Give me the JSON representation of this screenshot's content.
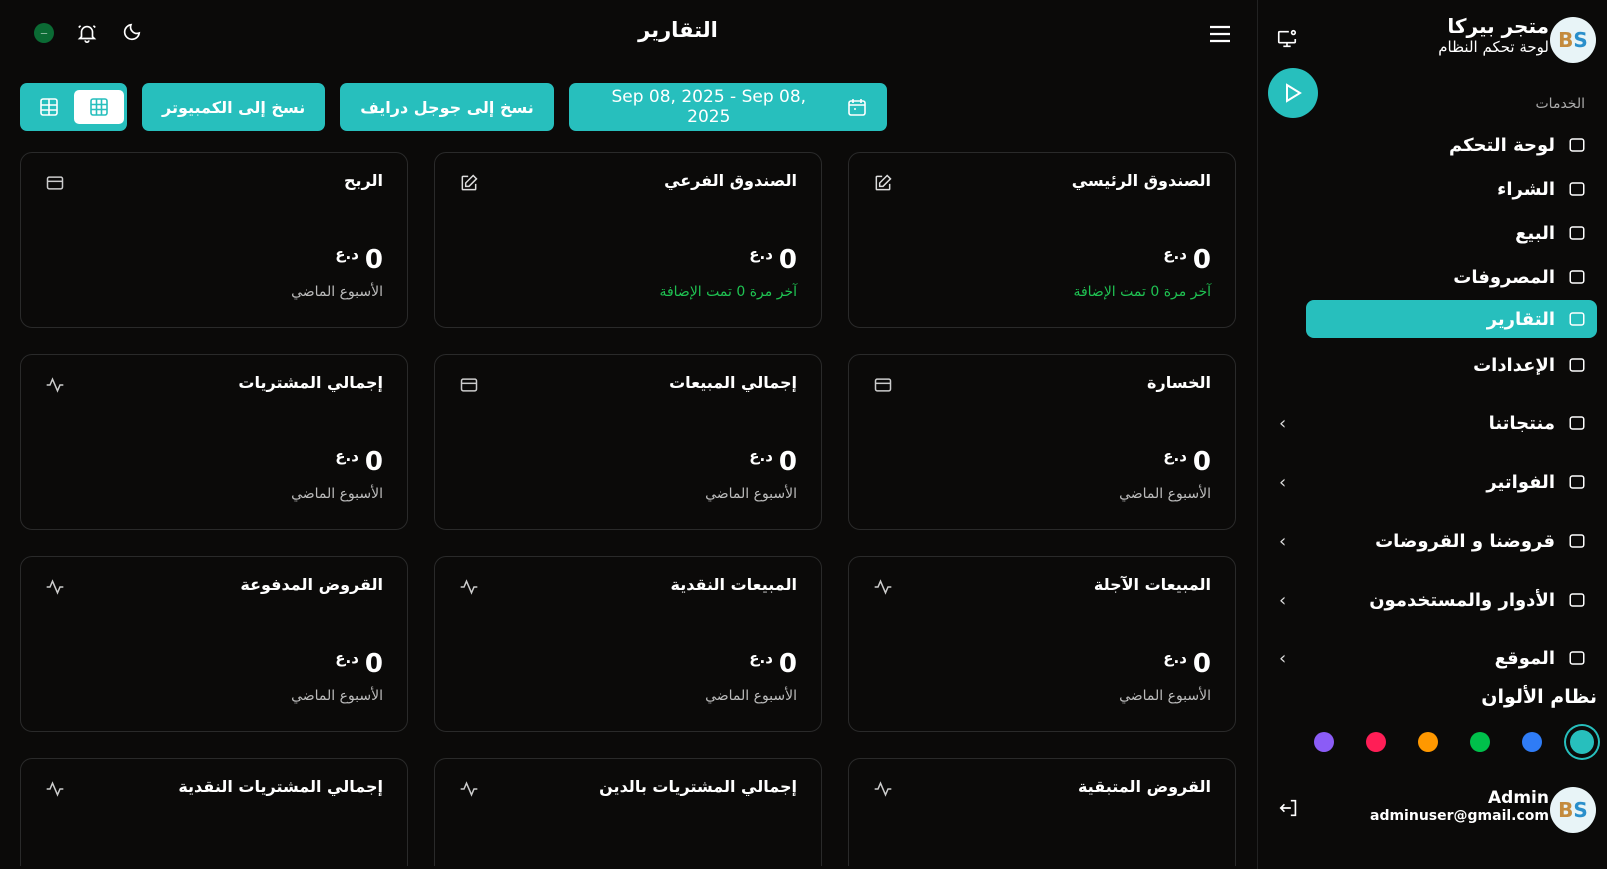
{
  "sidebar": {
    "brand_name": "متجر بيركا",
    "brand_sub": "لوحة تحكم النظام",
    "logo_text": "BS",
    "section_label": "الخدمات",
    "items": [
      {
        "label": "لوحة التحكم",
        "icon": "grid-icon"
      },
      {
        "label": "الشراء",
        "icon": "shopping-bag-icon"
      },
      {
        "label": "البيع",
        "icon": "pie-chart-icon"
      },
      {
        "label": "المصروفات",
        "icon": "credit-card-icon"
      },
      {
        "label": "التقارير",
        "icon": "report-icon",
        "active": true
      },
      {
        "label": "الإعدادات",
        "icon": "gear-icon"
      },
      {
        "label": "منتجاتنا",
        "icon": "basket-icon"
      },
      {
        "label": "الفواتير",
        "icon": "terminal-icon"
      },
      {
        "label": "قروضنا و القروضات",
        "icon": "money-icon"
      },
      {
        "label": "الأدوار والمستخدمون",
        "icon": "robot-icon"
      },
      {
        "label": "الموقع",
        "icon": "router-icon"
      }
    ],
    "color_scheme_title": "نظام الألوان",
    "colors": [
      "#27bfbd",
      "#2f7cf6",
      "#00c04b",
      "#ff9800",
      "#ff1e56",
      "#8b5cf6"
    ],
    "user": {
      "name": "Admin",
      "email": "adminuser@gmail.com"
    }
  },
  "header": {
    "title": "التقارير"
  },
  "toolbar": {
    "date_range": "Sep 08, 2025 - Sep 08, 2025",
    "copy_drive": "نسخ إلى جوجل درايف",
    "copy_computer": "نسخ إلى الكمبيوتر"
  },
  "cards": [
    {
      "title": "الصندوق الرئيسي",
      "value": "0",
      "currency": "د.ع",
      "sub": "آخر مرة 0 تمت الإضافة",
      "green": true,
      "icon": "edit"
    },
    {
      "title": "الصندوق الفرعي",
      "value": "0",
      "currency": "د.ع",
      "sub": "آخر مرة 0 تمت الإضافة",
      "green": true,
      "icon": "edit"
    },
    {
      "title": "الربح",
      "value": "0",
      "currency": "د.ع",
      "sub": "الأسبوع الماضي",
      "icon": "card"
    },
    {
      "title": "الخسارة",
      "value": "0",
      "currency": "د.ع",
      "sub": "الأسبوع الماضي",
      "icon": "card"
    },
    {
      "title": "إجمالي المبيعات",
      "value": "0",
      "currency": "د.ع",
      "sub": "الأسبوع الماضي",
      "icon": "card"
    },
    {
      "title": "إجمالي المشتريات",
      "value": "0",
      "currency": "د.ع",
      "sub": "الأسبوع الماضي",
      "icon": "activity"
    },
    {
      "title": "المبيعات الآجلة",
      "value": "0",
      "currency": "د.ع",
      "sub": "الأسبوع الماضي",
      "icon": "activity"
    },
    {
      "title": "المبيعات النقدية",
      "value": "0",
      "currency": "د.ع",
      "sub": "الأسبوع الماضي",
      "icon": "activity"
    },
    {
      "title": "القروض المدفوعة",
      "value": "0",
      "currency": "د.ع",
      "sub": "الأسبوع الماضي",
      "icon": "activity"
    },
    {
      "title": "القروض المتبقية",
      "icon": "activity"
    },
    {
      "title": "إجمالي المشتريات بالدين",
      "icon": "activity"
    },
    {
      "title": "إجمالي المشتريات النقدية",
      "icon": "activity"
    }
  ]
}
